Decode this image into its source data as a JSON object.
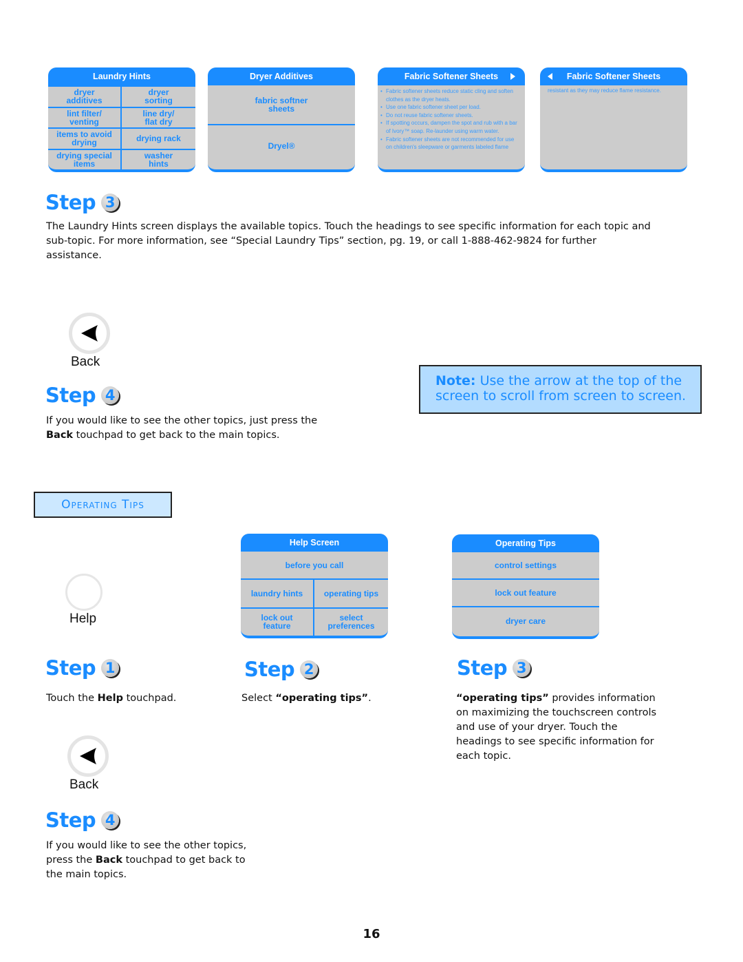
{
  "screens_top": {
    "laundry_hints": {
      "title": "Laundry Hints",
      "items": [
        "dryer additives",
        "dryer sorting",
        "lint filter/ venting",
        "line dry/ flat dry",
        "items to avoid drying",
        "drying rack",
        "drying special items",
        "washer hints"
      ]
    },
    "dryer_additives": {
      "title": "Dryer Additives",
      "items": [
        "fabric softner sheets",
        "Dryel®"
      ]
    },
    "fabric_softener_1": {
      "title": "Fabric Softener Sheets",
      "arrow": "arrow-right-icon",
      "bullets": [
        "Fabric softener sheets reduce static cling and soften clothes as the dryer heats.",
        "Use one fabric softener sheet per load.",
        "Do not reuse fabric softener sheets.",
        "If spotting occurs, dampen the spot and rub with  a bar of Ivory™ soap.  Re-launder using warm water.",
        "Fabric softener sheets are not recommended for use on children's sleepware or garments labeled flame"
      ]
    },
    "fabric_softener_2": {
      "title": "Fabric Softener Sheets",
      "arrow": "arrow-left-icon",
      "text": "resistant as they may reduce flame resistance."
    }
  },
  "laundry_step3": {
    "word": "Step",
    "num": "3",
    "text": "The Laundry Hints screen displays the available topics. Touch the headings to see specific information for each topic and sub-topic.  For more information, see “Special Laundry Tips” section, pg. 19, or call 1-888-462-9824 for further assistance."
  },
  "back_pad_1": {
    "label": "Back"
  },
  "laundry_step4": {
    "word": "Step",
    "num": "4",
    "text_before": "If you would like to see the other topics, just press the ",
    "bold": "Back",
    "text_after": " touchpad to get back to the main topics."
  },
  "note": {
    "label": "Note:",
    "text": " Use the arrow at the top of the screen to scroll from screen to screen."
  },
  "section": {
    "title": "Operating Tips"
  },
  "help_pad": {
    "label": "Help"
  },
  "help_screen": {
    "title": "Help Screen",
    "top_item": "before you call",
    "items": [
      "laundry hints",
      "operating tips",
      "lock out feature",
      "select preferences"
    ]
  },
  "operating_tips_screen": {
    "title": "Operating Tips",
    "items": [
      "control settings",
      "lock out feature",
      "dryer care"
    ]
  },
  "op_step1": {
    "word": "Step",
    "num": "1",
    "text_before": "Touch the ",
    "bold": "Help",
    "text_after": " touchpad."
  },
  "op_step2": {
    "word": "Step",
    "num": "2",
    "text_before": "Select ",
    "bold": "“operating tips”",
    "text_after": "."
  },
  "op_step3": {
    "word": "Step",
    "num": "3",
    "bold": "“operating tips”",
    "text_after": " provides information on maximizing the touchscreen controls and use of your dryer.  Touch the headings to see specific information for each topic."
  },
  "back_pad_2": {
    "label": "Back"
  },
  "op_step4": {
    "word": "Step",
    "num": "4",
    "text_before": "If you would like to see the other topics, press the ",
    "bold": "Back",
    "text_after": " touchpad to get back to the main topics."
  },
  "page_number": "16",
  "colors": {
    "accent": "#1a8cff",
    "panel_gray": "#cccccc",
    "note_bg": "#b3dcff"
  }
}
